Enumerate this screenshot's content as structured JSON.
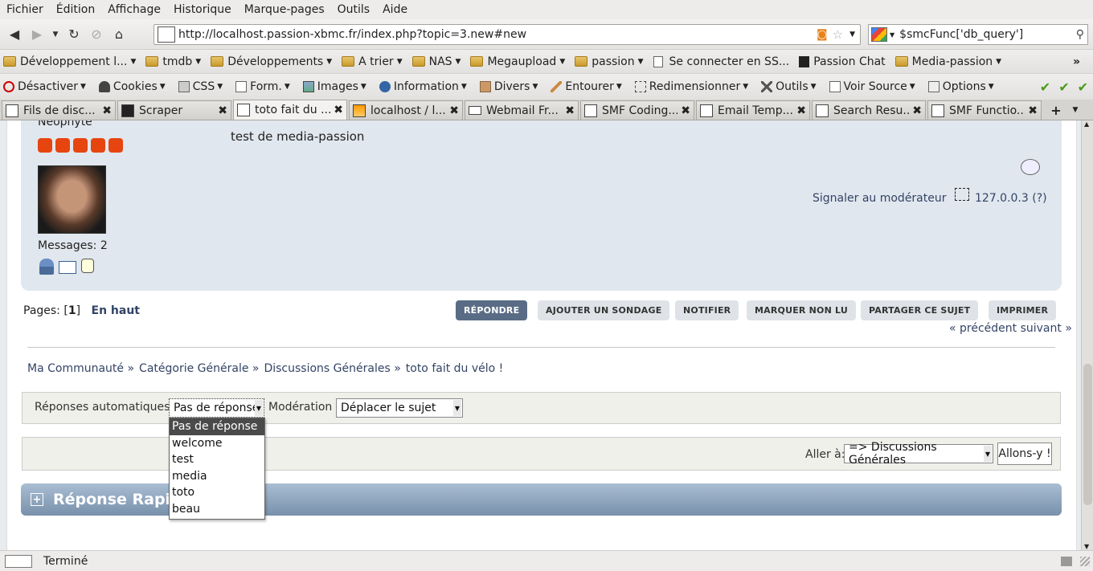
{
  "menu": [
    "Fichier",
    "Édition",
    "Affichage",
    "Historique",
    "Marque-pages",
    "Outils",
    "Aide"
  ],
  "url": "http://localhost.passion-xbmc.fr/index.php?topic=3.new#new",
  "search_value": "$smcFunc['db_query']",
  "bookmarks": [
    "Développement l...",
    "tmdb",
    "Développements",
    "A trier",
    "NAS",
    "Megaupload",
    "passion",
    "Se connecter en SS...",
    "Passion Chat",
    "Media-passion"
  ],
  "devbar": [
    "Désactiver",
    "Cookies",
    "CSS",
    "Form.",
    "Images",
    "Information",
    "Divers",
    "Entourer",
    "Redimensionner",
    "Outils",
    "Voir Source",
    "Options"
  ],
  "tabs": [
    "Fils de disc...",
    "Scraper",
    "toto fait du ...",
    "localhost / l...",
    "Webmail Fr...",
    "SMF Coding...",
    "Email Temp...",
    "Search Resu...",
    "SMF Functio..."
  ],
  "post": {
    "rank": "Néophyte",
    "body": "test de media-passion",
    "messages": "Messages: 2",
    "report": "Signaler au modérateur",
    "ip": "127.0.0.3 (?)"
  },
  "pages": {
    "label": "Pages: [",
    "num": "1",
    "close": "]",
    "top": "En haut"
  },
  "buttons": [
    "RÉPONDRE",
    "AJOUTER UN SONDAGE",
    "NOTIFIER",
    "MARQUER NON LU",
    "PARTAGER CE SUJET",
    "IMPRIMER"
  ],
  "prevnext": "« précédent suivant »",
  "breadcrumb": [
    "Ma Communauté »",
    "Catégorie Générale »",
    "Discussions Générales »",
    "toto fait du vélo !"
  ],
  "mod": {
    "auto_label": "Réponses automatiques :",
    "auto_value": "Pas de réponse",
    "mod_label": "Modération :",
    "mod_value": "Déplacer le sujet"
  },
  "jump": {
    "label": "Aller à:",
    "value": "=> Discussions Générales",
    "go": "Allons-y !"
  },
  "quick_reply": "Réponse Rapide",
  "dropdown_options": [
    "Pas de réponse",
    "welcome",
    "test",
    "media",
    "toto",
    "beau"
  ],
  "status": "Terminé"
}
